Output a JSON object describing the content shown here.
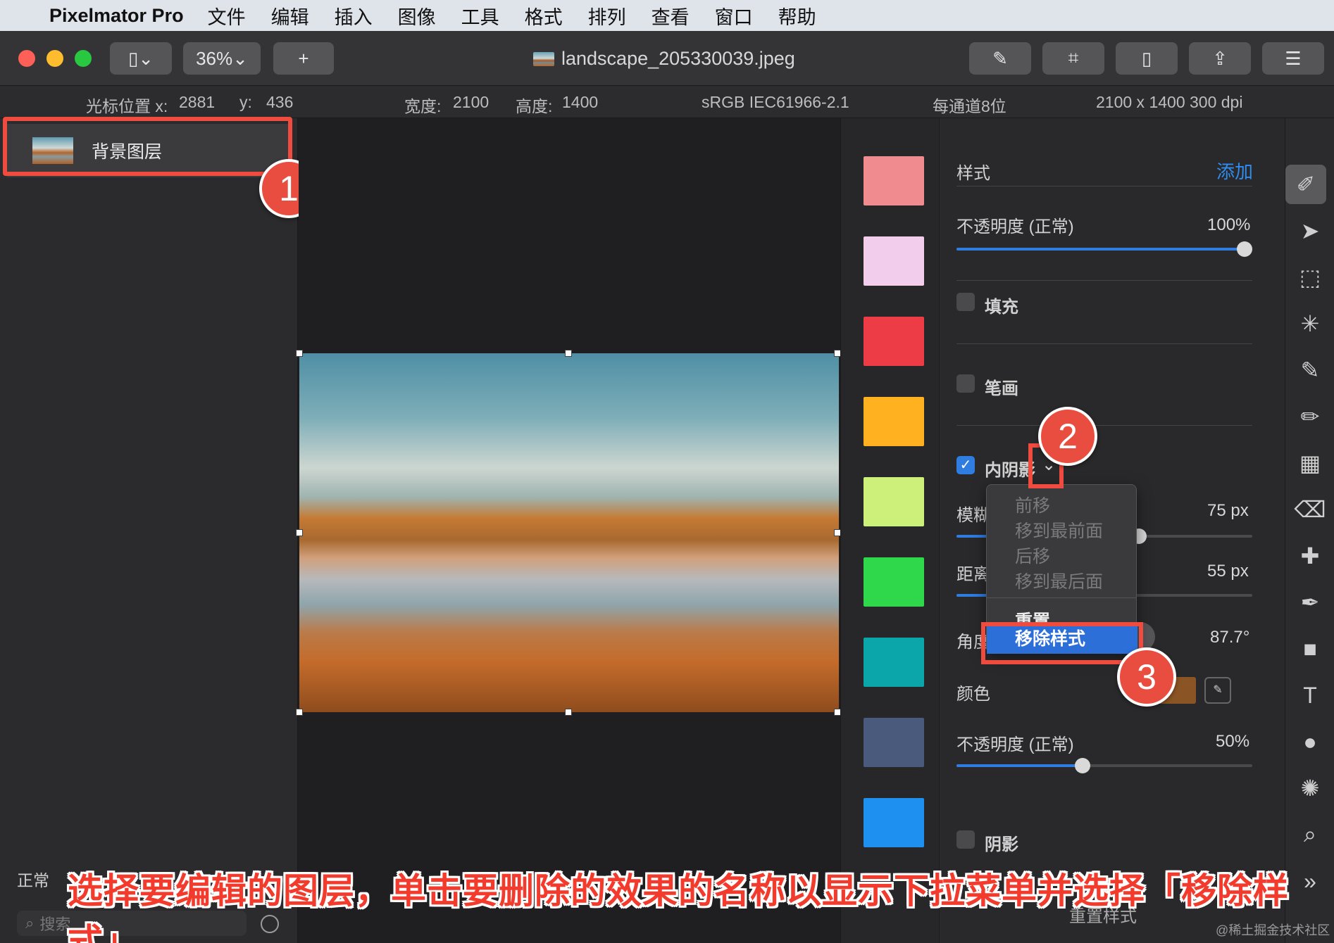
{
  "menubar": {
    "app": "Pixelmator Pro",
    "menus": [
      "文件",
      "编辑",
      "插入",
      "图像",
      "工具",
      "格式",
      "排列",
      "查看",
      "窗口",
      "帮助"
    ]
  },
  "toolbar": {
    "zoom": "36%",
    "add": "+",
    "document_title": "landscape_205330039.jpeg"
  },
  "infobar": {
    "cursor_x_label": "光标位置 x:",
    "cursor_x": "2881",
    "cursor_y_label": "y:",
    "cursor_y": "436",
    "width_label": "宽度:",
    "width": "2100",
    "height_label": "高度:",
    "height": "1400",
    "color_profile": "sRGB IEC61966-2.1",
    "bit_depth": "每通道8位",
    "resolution": "2100 x 1400 300 dpi"
  },
  "layers": {
    "items": [
      {
        "name": "背景图层"
      }
    ],
    "blend_mode": "正常",
    "search_placeholder": "搜索"
  },
  "swatch_colors": [
    "#f08c90",
    "#f2cdec",
    "#ee3c46",
    "#ffb11f",
    "#cdf07a",
    "#2fd84a",
    "#0aa6aa",
    "#4a5a7d",
    "#1e90f0"
  ],
  "style_panel": {
    "header": "样式",
    "add": "添加",
    "opacity_label": "不透明度 (正常)",
    "opacity_value": "100%",
    "fill_label": "填充",
    "stroke_label": "笔画",
    "inner_shadow_label": "内阴影",
    "blur_label": "模糊",
    "blur_value": "75 px",
    "distance_label": "距离",
    "distance_value": "55 px",
    "angle_label": "角度",
    "angle_value": "87.7°",
    "color_label": "颜色",
    "shadow_color": "#8b5424",
    "opacity2_label": "不透明度 (正常)",
    "opacity2_value": "50%",
    "shadow_label": "阴影",
    "reset_styles": "重置样式"
  },
  "dropdown": {
    "items": [
      "前移",
      "移到最前面",
      "后移",
      "移到最后面"
    ],
    "reset": "重置",
    "remove": "移除样式"
  },
  "badges": [
    "1",
    "2",
    "3"
  ],
  "caption": "选择要编辑的图层，单击要删除的效果的名称以显示下拉菜单并选择「移除样式」",
  "watermark": "@稀土掘金技术社区",
  "accent_color": "#2f7de1",
  "annotation_color": "#ef4c3f"
}
